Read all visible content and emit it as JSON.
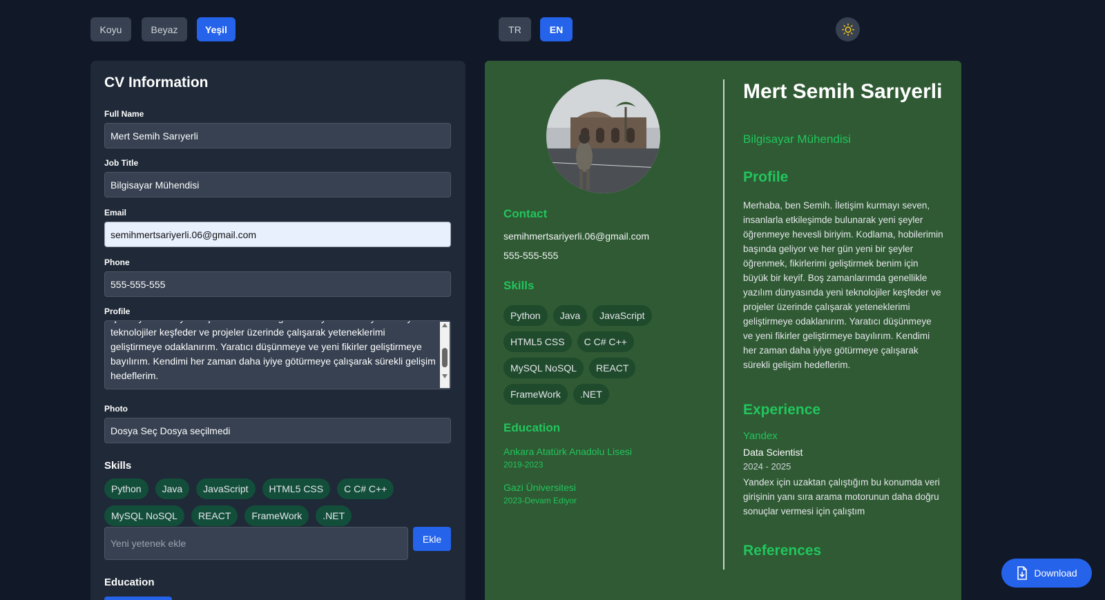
{
  "topbar": {
    "themes": [
      "Koyu",
      "Beyaz",
      "Yeşil"
    ],
    "languages": [
      "TR",
      "EN"
    ]
  },
  "form": {
    "title": "CV Information",
    "fields": {
      "full_name_label": "Full Name",
      "full_name_value": "Mert Semih Sarıyerli",
      "job_title_label": "Job Title",
      "job_title_value": "Bilgisayar Mühendisi",
      "email_label": "Email",
      "email_value": "semihmertsariyerli.06@gmail.com",
      "phone_label": "Phone",
      "phone_value": "555-555-555",
      "profile_label": "Profile",
      "profile_value": "için büyük bir keyif. Boş zamanlarımda genellikle yazılım dünyasında yeni teknolojiler keşfeder ve projeler üzerinde çalışarak yeteneklerimi geliştirmeye odaklanırım. Yaratıcı düşünmeye ve yeni fikirler geliştirmeye bayılırım. Kendimi her zaman daha iyiye götürmeye çalışarak sürekli gelişim hedeflerim.",
      "photo_label": "Photo",
      "photo_value": "Dosya Seç Dosya seçilmedi"
    },
    "skills_heading": "Skills",
    "skill_input_placeholder": "Yeni yetenek ekle",
    "add_button": "Ekle",
    "education_heading": "Education"
  },
  "skills": [
    "Python",
    "Java",
    "JavaScript",
    "HTML5 CSS",
    "C C# C++",
    "MySQL NoSQL",
    "REACT",
    "FrameWork",
    ".NET"
  ],
  "cv": {
    "name": "Mert Semih Sarıyerli",
    "job_title": "Bilgisayar Mühendisi",
    "contact_heading": "Contact",
    "email": "semihmertsariyerli.06@gmail.com",
    "phone": "555-555-555",
    "skills_heading": "Skills",
    "education_heading": "Education",
    "education": [
      {
        "school": "Ankara Atatürk Anadolu Lisesi",
        "years": "2019-2023"
      },
      {
        "school": "Gazi Üniversitesi",
        "years": "2023-Devam Ediyor"
      }
    ],
    "profile_heading": "Profile",
    "profile_text": "Merhaba, ben Semih. İletişim kurmayı seven, insanlarla etkileşimde bulunarak yeni şeyler öğrenmeye hevesli biriyim. Kodlama, hobilerimin başında geliyor ve her gün yeni bir şeyler öğrenmek, fikirlerimi geliştirmek benim için büyük bir keyif. Boş zamanlarımda genellikle yazılım dünyasında yeni teknolojiler keşfeder ve projeler üzerinde çalışarak yeteneklerimi geliştirmeye odaklanırım. Yaratıcı düşünmeye ve yeni fikirler geliştirmeye bayılırım. Kendimi her zaman daha iyiye götürmeye çalışarak sürekli gelişim hedeflerim.",
    "experience_heading": "Experience",
    "experience": {
      "company": "Yandex",
      "role": "Data Scientist",
      "years": "2024 - 2025",
      "description": "Yandex için uzaktan çalıştığım bu konumda veri girişinin yanı sıra arama motorunun daha doğru sonuçlar vermesi için çalıştım"
    },
    "references_heading": "References"
  },
  "download_button": "Download",
  "icons": {
    "theme": "sun-icon",
    "download": "download-file-icon"
  },
  "colors": {
    "accent": "#2563eb",
    "green": "#22c55e",
    "cv_bg": "#2f5a33"
  }
}
